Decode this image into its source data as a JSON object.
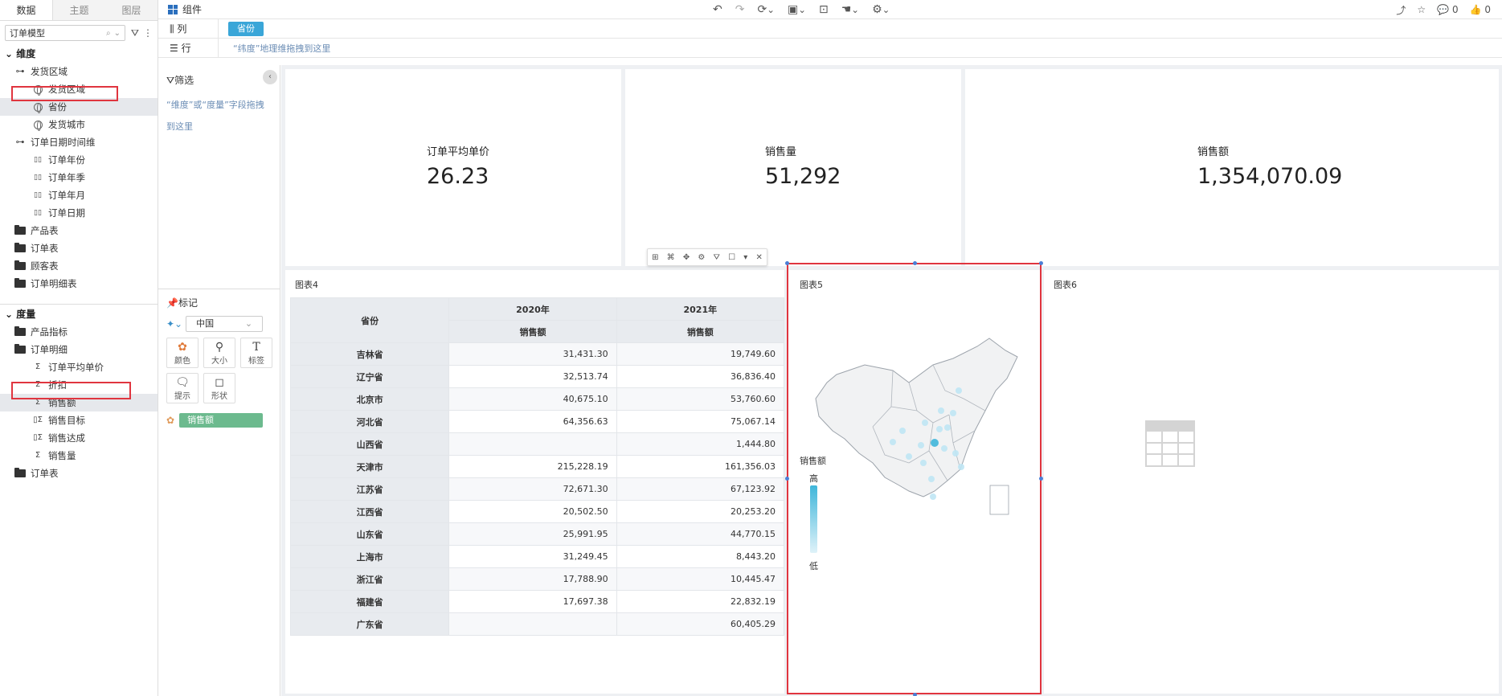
{
  "left_panel": {
    "tabs": [
      "数据",
      "主题",
      "图层"
    ],
    "model": "订单模型",
    "dimension_title": "维度",
    "dimensions": [
      {
        "label": "发货区域",
        "level": 1,
        "icon": "hierarchy-icon"
      },
      {
        "label": "发货区域",
        "level": 2,
        "icon": "globe-icon"
      },
      {
        "label": "省份",
        "level": 2,
        "icon": "globe-icon",
        "selected": true
      },
      {
        "label": "发货城市",
        "level": 2,
        "icon": "globe-icon"
      },
      {
        "label": "订单日期时间维",
        "level": 1,
        "icon": "hierarchy-icon"
      },
      {
        "label": "订单年份",
        "level": 2,
        "icon": "date-icon"
      },
      {
        "label": "订单年季",
        "level": 2,
        "icon": "date-icon"
      },
      {
        "label": "订单年月",
        "level": 2,
        "icon": "date-icon"
      },
      {
        "label": "订单日期",
        "level": 2,
        "icon": "date-icon"
      },
      {
        "label": "产品表",
        "level": 1,
        "icon": "folder-icon"
      },
      {
        "label": "订单表",
        "level": 1,
        "icon": "folder-icon"
      },
      {
        "label": "顾客表",
        "level": 1,
        "icon": "folder-icon"
      },
      {
        "label": "订单明细表",
        "level": 1,
        "icon": "folder-icon"
      }
    ],
    "measure_title": "度量",
    "measures": [
      {
        "label": "产品指标",
        "level": 1,
        "icon": "folder-icon"
      },
      {
        "label": "订单明细",
        "level": 1,
        "icon": "folder-icon"
      },
      {
        "label": "订单平均单价",
        "level": 2,
        "icon": "sigma-icon"
      },
      {
        "label": "折扣",
        "level": 2,
        "icon": "sigma-icon"
      },
      {
        "label": "销售额",
        "level": 2,
        "icon": "sigma-icon",
        "selected": true
      },
      {
        "label": "销售目标",
        "level": 2,
        "icon": "calc-sigma-icon"
      },
      {
        "label": "销售达成",
        "level": 2,
        "icon": "calc-sigma-icon"
      },
      {
        "label": "销售量",
        "level": 2,
        "icon": "sigma-icon"
      },
      {
        "label": "订单表",
        "level": 1,
        "icon": "folder-icon"
      }
    ]
  },
  "topbar": {
    "component_label": "组件",
    "comments": "0",
    "likes": "0"
  },
  "shelves": {
    "column_label": "列",
    "column_pill": "省份",
    "row_label": "行",
    "row_hint": "“纬度”地理维拖拽到这里"
  },
  "mid_panel": {
    "filter_title": "筛选",
    "filter_hint": "“维度”或“度量”字段拖拽到这里",
    "mark_title": "标记",
    "map_type": "中国",
    "mark_buttons": [
      "颜色",
      "大小",
      "标签",
      "提示",
      "形状"
    ],
    "color_measure": "销售额"
  },
  "kpis": [
    {
      "label": "订单平均单价",
      "value": "26.23"
    },
    {
      "label": "销售量",
      "value": "51,292"
    },
    {
      "label": "销售额",
      "value": "1,354,070.09"
    }
  ],
  "table_chart": {
    "title": "图表4",
    "row_header": "省份",
    "years": [
      "2020年",
      "2021年"
    ],
    "measure": "销售额",
    "rows": [
      {
        "province": "吉林省",
        "v2020": "31,431.30",
        "v2021": "19,749.60"
      },
      {
        "province": "辽宁省",
        "v2020": "32,513.74",
        "v2021": "36,836.40"
      },
      {
        "province": "北京市",
        "v2020": "40,675.10",
        "v2021": "53,760.60"
      },
      {
        "province": "河北省",
        "v2020": "64,356.63",
        "v2021": "75,067.14"
      },
      {
        "province": "山西省",
        "v2020": "",
        "v2021": "1,444.80"
      },
      {
        "province": "天津市",
        "v2020": "215,228.19",
        "v2021": "161,356.03"
      },
      {
        "province": "江苏省",
        "v2020": "72,671.30",
        "v2021": "67,123.92"
      },
      {
        "province": "江西省",
        "v2020": "20,502.50",
        "v2021": "20,253.20"
      },
      {
        "province": "山东省",
        "v2020": "25,991.95",
        "v2021": "44,770.15"
      },
      {
        "province": "上海市",
        "v2020": "31,249.45",
        "v2021": "8,443.20"
      },
      {
        "province": "浙江省",
        "v2020": "17,788.90",
        "v2021": "10,445.47"
      },
      {
        "province": "福建省",
        "v2020": "17,697.38",
        "v2021": "22,832.19"
      },
      {
        "province": "广东省",
        "v2020": "",
        "v2021": "60,405.29"
      }
    ]
  },
  "map_chart": {
    "title": "图表5",
    "legend_title": "销售额",
    "legend_high": "高",
    "legend_low": "低",
    "colors": {
      "high": "#3fb6da",
      "low": "#dff2f9",
      "selection": "#e0353f"
    }
  },
  "empty_chart": {
    "title": "图表6"
  }
}
